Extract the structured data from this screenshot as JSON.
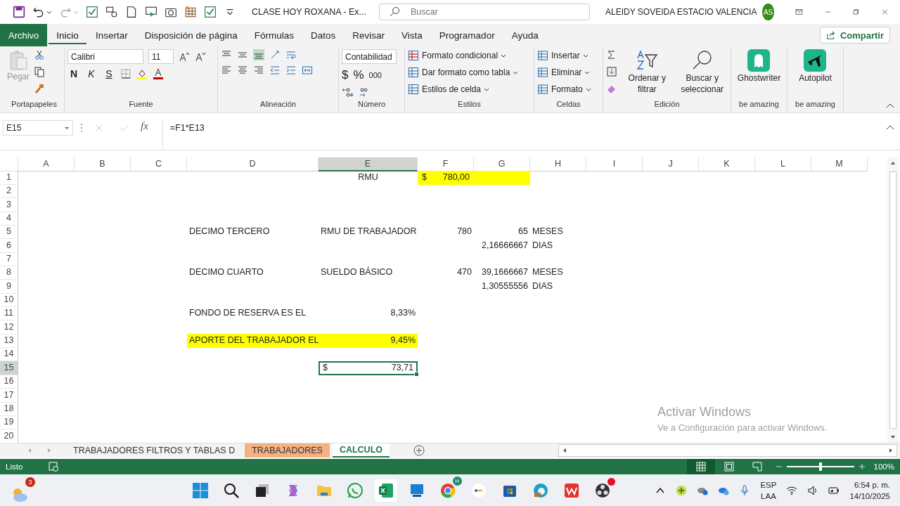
{
  "title_bar": {
    "title": "CLASE HOY ROXANA  -  Ex...",
    "search": {
      "placeholder": "Buscar"
    },
    "user": "ALEIDY SOVEIDA ESTACIO VALENCIA",
    "avatar": "AS"
  },
  "tabs": [
    {
      "label": "Archivo",
      "kind": "file",
      "selected": false
    },
    {
      "label": "Inicio",
      "kind": "tab",
      "selected": true
    },
    {
      "label": "Insertar",
      "kind": "tab",
      "selected": false
    },
    {
      "label": "Disposición de página",
      "kind": "tab",
      "selected": false
    },
    {
      "label": "Fórmulas",
      "kind": "tab",
      "selected": false
    },
    {
      "label": "Datos",
      "kind": "tab",
      "selected": false
    },
    {
      "label": "Revisar",
      "kind": "tab",
      "selected": false
    },
    {
      "label": "Vista",
      "kind": "tab",
      "selected": false
    },
    {
      "label": "Programador",
      "kind": "tab",
      "selected": false
    },
    {
      "label": "Ayuda",
      "kind": "tab",
      "selected": false
    }
  ],
  "share_button": "Compartir",
  "ribbon": {
    "groups": [
      {
        "kind": "clipboard",
        "label": "Portapapeles",
        "paste": "Pegar"
      },
      {
        "kind": "font",
        "label": "Fuente",
        "font": "Calibri",
        "size": "11",
        "bold": "N",
        "italic": "K",
        "underline": "S"
      },
      {
        "kind": "alignment",
        "label": "Alineación"
      },
      {
        "kind": "number",
        "label": "Número",
        "format": "Contabilidad",
        "currency": "$",
        "percent": "%",
        "thousands": "000"
      },
      {
        "kind": "styles",
        "label": "Estilos",
        "items": [
          "Formato condicional",
          "Dar formato como tabla",
          "Estilos de celda"
        ]
      },
      {
        "kind": "cells",
        "label": "Celdas",
        "items": [
          "Insertar",
          "Eliminar",
          "Formato"
        ]
      },
      {
        "kind": "editing",
        "label": "Edición",
        "sort": "Ordenar y filtrar",
        "find": "Buscar y seleccionar"
      },
      {
        "kind": "ghostwriter",
        "label": "be amazing",
        "name": "Ghostwriter"
      },
      {
        "kind": "autopilot",
        "label": "be amazing",
        "name": "Autopilot"
      }
    ]
  },
  "formula_bar": {
    "name_box": "E15",
    "fx": "fx",
    "formula": "=F1*E13"
  },
  "columns": [
    {
      "label": "A",
      "selected": false
    },
    {
      "label": "B",
      "selected": false
    },
    {
      "label": "C",
      "selected": false
    },
    {
      "label": "D",
      "selected": false
    },
    {
      "label": "E",
      "selected": true
    },
    {
      "label": "F",
      "selected": false
    },
    {
      "label": "G",
      "selected": false
    },
    {
      "label": "H",
      "selected": false
    },
    {
      "label": "I",
      "selected": false
    },
    {
      "label": "J",
      "selected": false
    },
    {
      "label": "K",
      "selected": false
    },
    {
      "label": "L",
      "selected": false
    },
    {
      "label": "M",
      "selected": false
    }
  ],
  "rows": [
    {
      "number": "1",
      "selected": false,
      "cells": {
        "E": {
          "kind": "heading",
          "text": "RMU"
        },
        "F": {
          "kind": "accounting",
          "symbol": "$",
          "text": "780,00",
          "highlighted": true
        },
        "G": {
          "kind": "text",
          "highlighted": true
        }
      }
    },
    {
      "number": "2",
      "selected": false,
      "cells": {}
    },
    {
      "number": "3",
      "selected": false,
      "cells": {}
    },
    {
      "number": "4",
      "selected": false,
      "cells": {}
    },
    {
      "number": "5",
      "selected": false,
      "cells": {
        "D": {
          "kind": "text",
          "text": "DECIMO TERCERO"
        },
        "E": {
          "kind": "text",
          "text": "RMU DE TRABAJADOR"
        },
        "F": {
          "kind": "number",
          "text": "780"
        },
        "G": {
          "kind": "number",
          "text": "65"
        },
        "H": {
          "kind": "text",
          "text": "MESES"
        }
      }
    },
    {
      "number": "6",
      "selected": false,
      "cells": {
        "G": {
          "kind": "number",
          "text": "2,16666667"
        },
        "H": {
          "kind": "text",
          "text": "DIAS"
        }
      }
    },
    {
      "number": "7",
      "selected": false,
      "cells": {}
    },
    {
      "number": "8",
      "selected": false,
      "cells": {
        "D": {
          "kind": "text",
          "text": "DECIMO CUARTO"
        },
        "E": {
          "kind": "text",
          "text": "SUELDO BÁSICO"
        },
        "F": {
          "kind": "number",
          "text": "470"
        },
        "G": {
          "kind": "number",
          "text": "39,1666667"
        },
        "H": {
          "kind": "text",
          "text": "MESES"
        }
      }
    },
    {
      "number": "9",
      "selected": false,
      "cells": {
        "G": {
          "kind": "number",
          "text": "1,30555556"
        },
        "H": {
          "kind": "text",
          "text": "DIAS"
        }
      }
    },
    {
      "number": "10",
      "selected": false,
      "cells": {}
    },
    {
      "number": "11",
      "selected": false,
      "cells": {
        "D": {
          "kind": "text",
          "text": "FONDO DE RESERVA ES EL"
        },
        "E": {
          "kind": "number",
          "text": "8,33%"
        }
      }
    },
    {
      "number": "12",
      "selected": false,
      "cells": {}
    },
    {
      "number": "13",
      "selected": false,
      "cells": {
        "D": {
          "kind": "text",
          "text": "APORTE DEL TRABAJADOR EL",
          "highlighted": true
        },
        "E": {
          "kind": "number",
          "text": "9,45%",
          "highlighted": true
        }
      }
    },
    {
      "number": "14",
      "selected": false,
      "cells": {}
    },
    {
      "number": "15",
      "selected": true,
      "cells": {
        "E": {
          "kind": "accounting",
          "symbol": "$",
          "text": "73,71",
          "selected": true
        }
      }
    },
    {
      "number": "16",
      "selected": false,
      "cells": {}
    },
    {
      "number": "17",
      "selected": false,
      "cells": {}
    },
    {
      "number": "18",
      "selected": false,
      "cells": {}
    },
    {
      "number": "19",
      "selected": false,
      "cells": {}
    },
    {
      "number": "20",
      "selected": false,
      "cells": {}
    }
  ],
  "activation_notice": {
    "title": "Activar Windows",
    "message": "Ve a Configuración para activar Windows."
  },
  "sheet_tabs": [
    {
      "label": "TRABAJADORES FILTROS Y TABLAS D",
      "selected": false
    },
    {
      "label": "TRABAJADORES",
      "selected": false,
      "color": "#f4b183"
    },
    {
      "label": "CALCULO",
      "selected": true
    }
  ],
  "status_bar": {
    "status": "Listo",
    "views": [
      {
        "kind": "normal",
        "selected": true
      },
      {
        "kind": "layout",
        "selected": false
      },
      {
        "kind": "pagebreak",
        "selected": false
      }
    ],
    "zoom": {
      "level": 0.5,
      "label": "100%"
    }
  },
  "taskbar": {
    "weather_badge": "3",
    "chrome_badge": "H",
    "language": "ESP",
    "region": "LAA",
    "time": "6:54 p. m.",
    "date": "14/10/2025"
  }
}
